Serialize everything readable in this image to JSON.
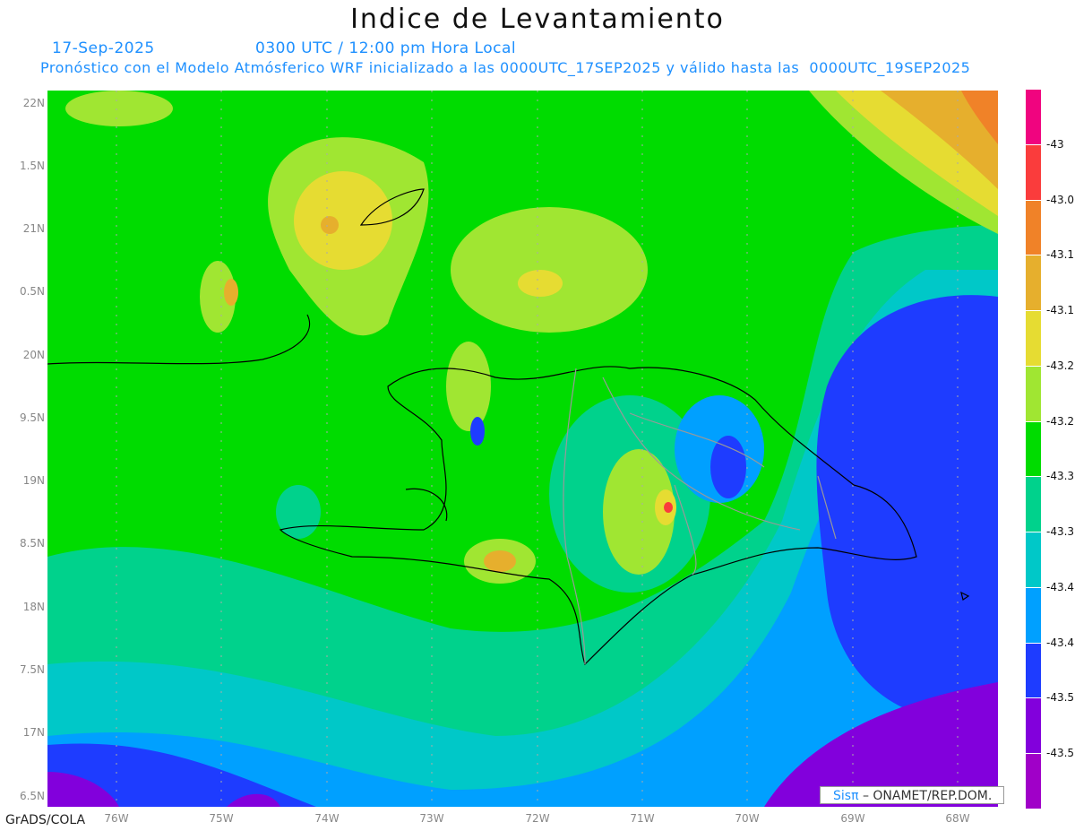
{
  "title": "Indice de Levantamiento",
  "date": "17-Sep-2025",
  "time": "0300 UTC / 12:00 pm Hora Local",
  "forecast_note": "Pronóstico con el Modelo Atmósferico WRF inicializado a las 0000UTC_17SEP2025 y válido hasta las  0000UTC_19SEP2025",
  "lat_labels": [
    "22N",
    "1.5N",
    "21N",
    "0.5N",
    "20N",
    "9.5N",
    "19N",
    "8.5N",
    "18N",
    "7.5N",
    "17N",
    "6.5N"
  ],
  "lon_labels": [
    "76W",
    "75W",
    "74W",
    "73W",
    "72W",
    "71W",
    "70W",
    "69W",
    "68W"
  ],
  "colorbar": {
    "colors": [
      "#f0047f",
      "#fa3c3c",
      "#f08228",
      "#e6af2d",
      "#e6dc32",
      "#a0e632",
      "#00dc00",
      "#00d28c",
      "#00c8c8",
      "#00a0ff",
      "#1e3cff",
      "#8200dc",
      "#a000c8"
    ],
    "labels": [
      "-43",
      "-43.0",
      "-43.1",
      "-43.1",
      "-43.2",
      "-43.2",
      "-43.3",
      "-43.3",
      "-43.4",
      "-43.4",
      "-43.5",
      "-43.5"
    ]
  },
  "credit": {
    "logo": "Sisπ",
    "text": "– ONAMET/REP.DOM."
  },
  "footer": "GrADS/COLA"
}
